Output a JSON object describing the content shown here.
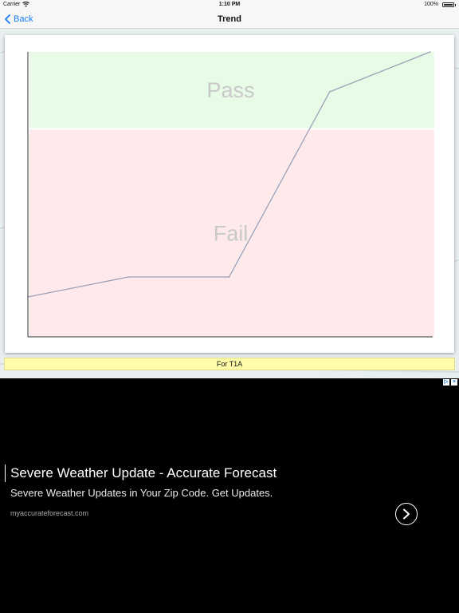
{
  "status_bar": {
    "carrier": "Carrier",
    "time": "1:10 PM",
    "battery": "100%"
  },
  "nav": {
    "back_label": "Back",
    "title": "Trend"
  },
  "chart_data": {
    "type": "line",
    "zones": [
      {
        "label": "Pass",
        "from": 0.73,
        "to": 1.0,
        "color": "#e8fbe6"
      },
      {
        "label": "Fail",
        "from": 0.0,
        "to": 0.73,
        "color": "#feeaea"
      }
    ],
    "x": [
      0,
      1,
      2,
      3,
      4
    ],
    "series": [
      {
        "values": [
          0.14,
          0.21,
          0.21,
          0.86,
          1.0
        ],
        "color": "#9aa0b8"
      }
    ],
    "xlim": [
      0,
      4
    ],
    "ylim": [
      0,
      1
    ],
    "grid": false,
    "zone_label_color": "#c9c9c9",
    "axis_color": "#333333"
  },
  "caption": "For T1A",
  "ad": {
    "choices_left": "▷",
    "choices_right": "×",
    "headline": "Severe Weather Update - Accurate Forecast",
    "body": "Severe Weather Updates in Your Zip Code. Get Updates.",
    "url": "myaccurateforecast.com"
  }
}
